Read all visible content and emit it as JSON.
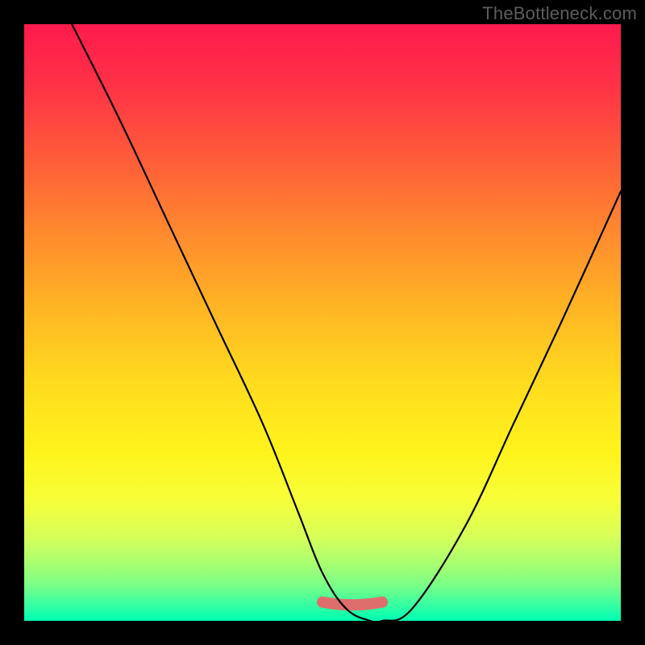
{
  "watermark": "TheBottleneck.com",
  "chart_data": {
    "type": "line",
    "title": "",
    "xlabel": "",
    "ylabel": "",
    "xlim": [
      0,
      100
    ],
    "ylim": [
      0,
      100
    ],
    "grid": false,
    "series": [
      {
        "name": "bottleneck-curve",
        "x": [
          8,
          16,
          24,
          32,
          40,
          46,
          50,
          54,
          58,
          60,
          65,
          74,
          82,
          90,
          100
        ],
        "y": [
          100,
          84,
          67,
          50,
          33,
          18,
          8,
          2,
          0,
          0,
          2,
          16,
          33,
          50,
          72
        ],
        "color": "#000000"
      }
    ],
    "annotations": [
      {
        "name": "trough-highlight",
        "type": "overlay-segment",
        "x": [
          50,
          60
        ],
        "y": [
          3,
          3
        ],
        "color": "#de6e6b"
      }
    ],
    "background_gradient": {
      "direction": "vertical",
      "stops": [
        {
          "pos": 0.0,
          "color": "#ff1a4d"
        },
        {
          "pos": 0.22,
          "color": "#ff5a3a"
        },
        {
          "pos": 0.48,
          "color": "#ffb724"
        },
        {
          "pos": 0.72,
          "color": "#fff41c"
        },
        {
          "pos": 0.9,
          "color": "#adff6e"
        },
        {
          "pos": 1.0,
          "color": "#00ffb3"
        }
      ]
    }
  }
}
